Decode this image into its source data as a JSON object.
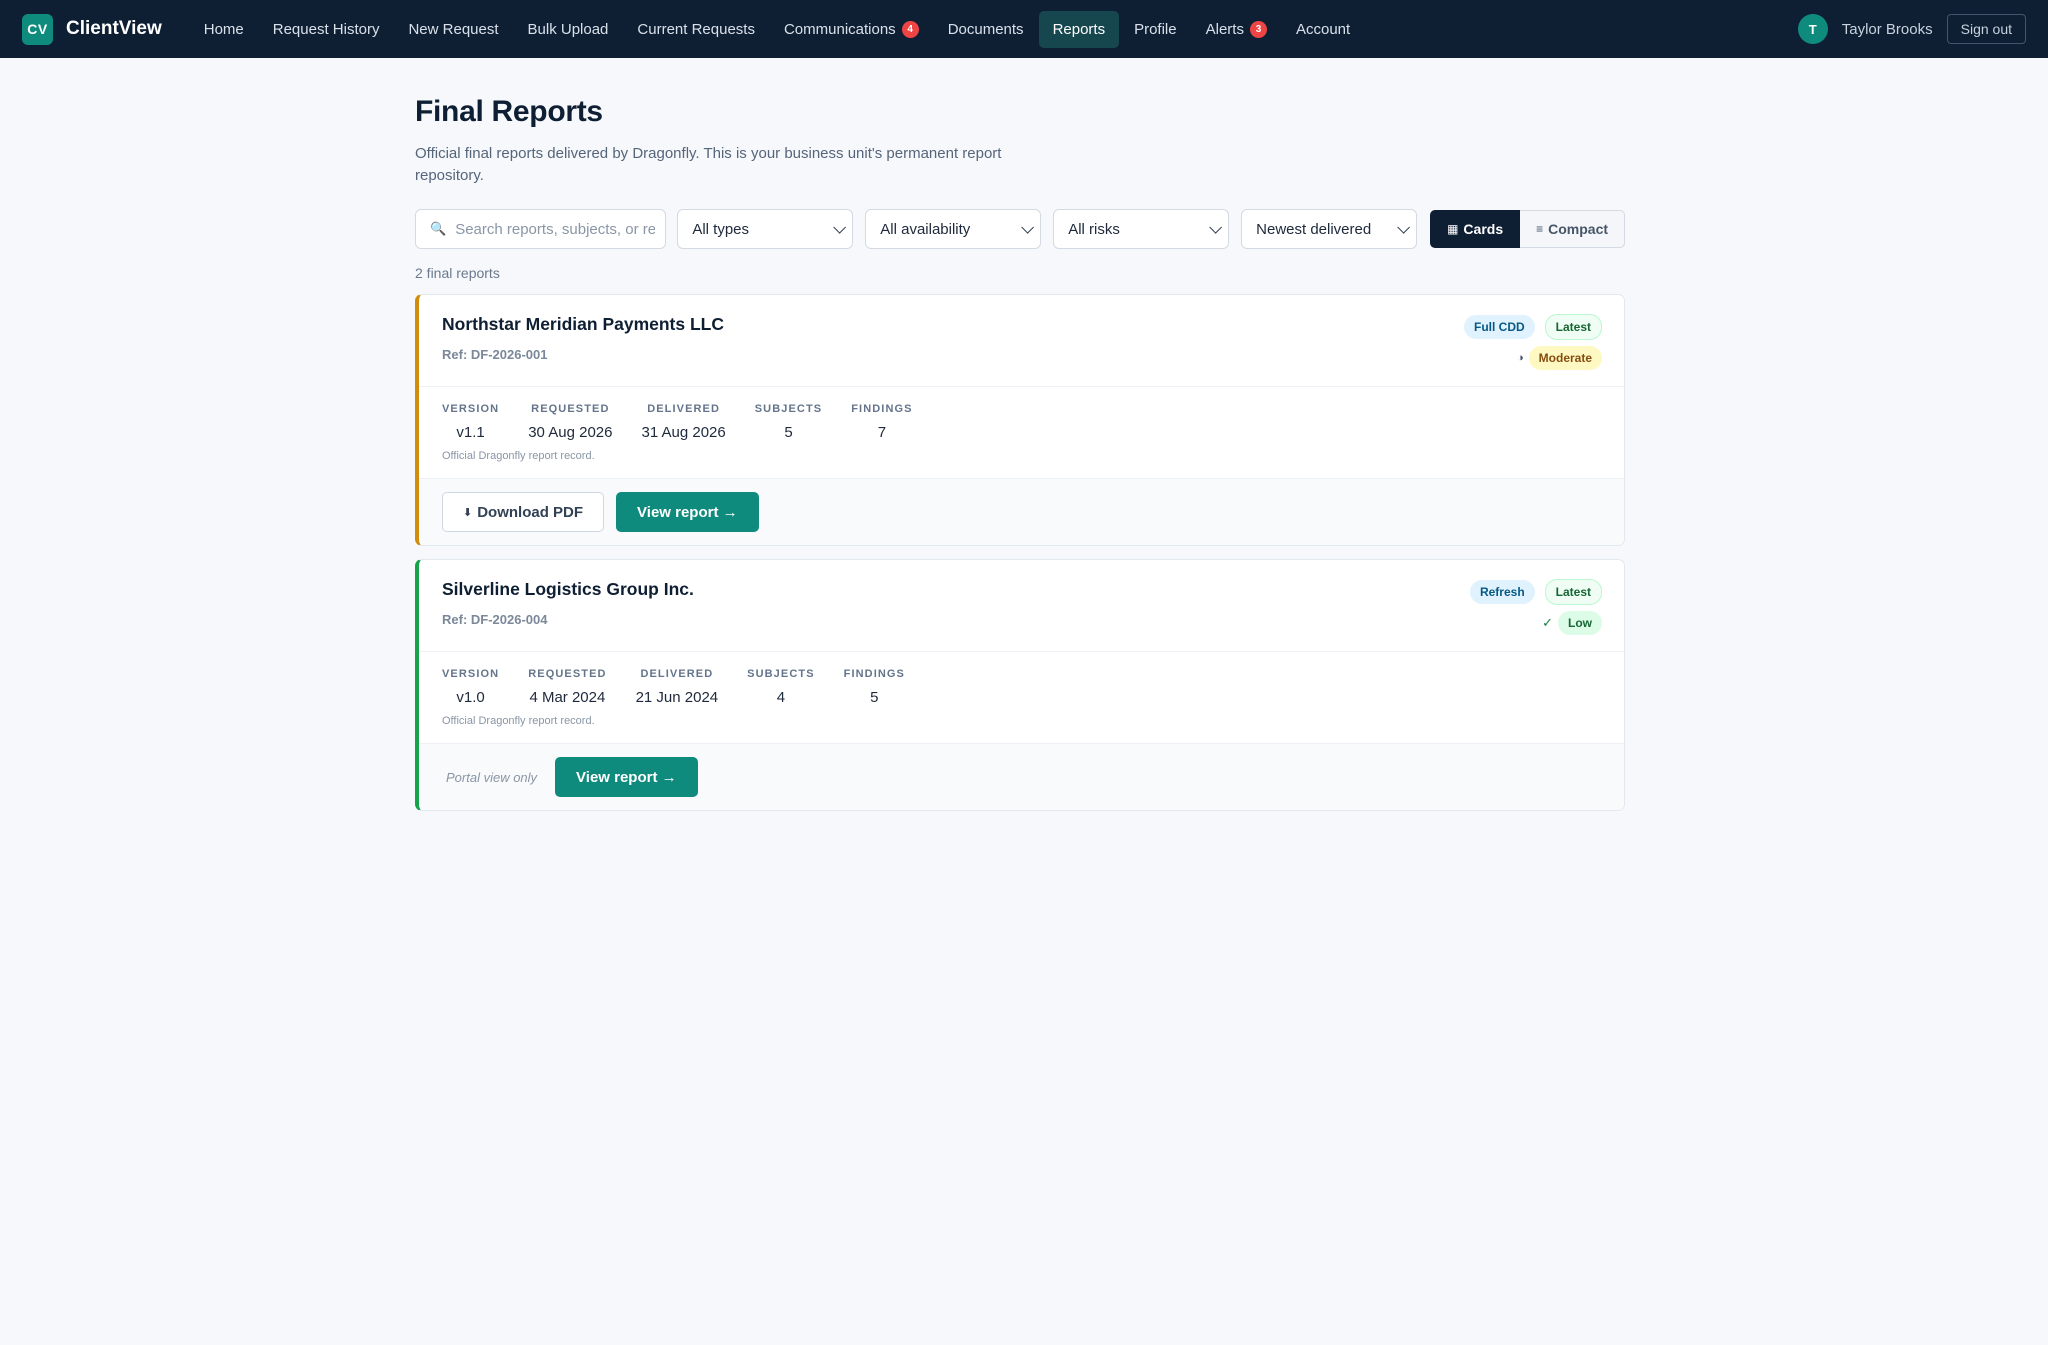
{
  "app": {
    "logo": "CV",
    "name": "ClientView"
  },
  "nav": {
    "items": [
      {
        "label": "Home"
      },
      {
        "label": "Request History"
      },
      {
        "label": "New Request"
      },
      {
        "label": "Bulk Upload"
      },
      {
        "label": "Current Requests"
      },
      {
        "label": "Communications",
        "badge": "4"
      },
      {
        "label": "Documents"
      },
      {
        "label": "Reports",
        "active": true
      },
      {
        "label": "Profile"
      },
      {
        "label": "Alerts",
        "badge": "3"
      },
      {
        "label": "Account"
      }
    ],
    "user_initial": "T",
    "user_name": "Taylor Brooks",
    "signout_label": "Sign out"
  },
  "page": {
    "title": "Final Reports",
    "subtitle": "Official final reports delivered by Dragonfly. This is your business unit's permanent report repository."
  },
  "filters": {
    "search_placeholder": "Search reports, subjects, or re",
    "type": "All types",
    "availability": "All availability",
    "risk": "All risks",
    "sort": "Newest delivered",
    "view_cards": "Cards",
    "view_compact": "Compact"
  },
  "count_label": "2 final reports",
  "stat_labels": {
    "version": "VERSION",
    "requested": "REQUESTED",
    "delivered": "DELIVERED",
    "subjects": "SUBJECTS",
    "findings": "FINDINGS"
  },
  "reports": [
    {
      "title": "Northstar Meridian Payments LLC",
      "ref": "Ref: DF-2026-001",
      "type_badge": "Full CDD",
      "latest_badge": "Latest",
      "risk_icon": "◑",
      "risk": "Moderate",
      "risk_color": "#d18c0c",
      "version": "v1.1",
      "requested": "30 Aug 2026",
      "delivered": "31 Aug 2026",
      "subjects": "5",
      "findings": "7",
      "note": "Official Dragonfly report record.",
      "download_label": "Download PDF",
      "view_label": "View report →"
    },
    {
      "title": "Silverline Logistics Group Inc.",
      "ref": "Ref: DF-2026-004",
      "type_badge": "Refresh",
      "latest_badge": "Latest",
      "risk_icon": "✓",
      "risk": "Low",
      "risk_color": "#16a34a",
      "version": "v1.0",
      "requested": "4 Mar 2024",
      "delivered": "21 Jun 2024",
      "subjects": "4",
      "findings": "5",
      "note": "Official Dragonfly report record.",
      "portal_note": "Portal view only",
      "view_label": "View report →"
    }
  ]
}
